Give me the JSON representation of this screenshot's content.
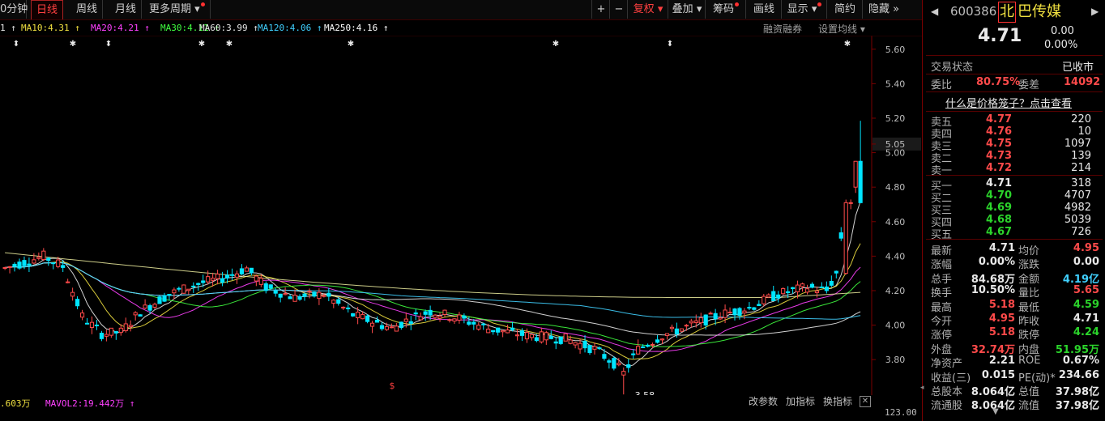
{
  "topbar": {
    "tabs": [
      {
        "label": "0分钟",
        "active": false
      },
      {
        "label": "日线",
        "active": true
      },
      {
        "label": "周线",
        "active": false
      },
      {
        "label": "月线",
        "active": false
      },
      {
        "label": "更多周期",
        "active": false
      }
    ],
    "buttons": [
      "+",
      "−",
      "复权",
      "叠加",
      "筹码",
      "画线",
      "显示",
      "简约",
      "隐藏"
    ]
  },
  "ma_legend": [
    {
      "label": "1 ↑",
      "color": "#e8e8e8"
    },
    {
      "label": "MA10:4.31 ↑",
      "color": "#f0e040"
    },
    {
      "label": "MA20:4.21 ↑",
      "color": "#ff40ff"
    },
    {
      "label": "MA30:4.11 ↑",
      "color": "#40ff40"
    },
    {
      "label": "MA60:3.99 ↑",
      "color": "#e8e8e8"
    },
    {
      "label": "MA120:4.06 ↑",
      "color": "#40d0ff"
    },
    {
      "label": "MA250:4.16 ↑",
      "color": "#ffffff"
    }
  ],
  "chart_opts": [
    "融资融券",
    "设置均线"
  ],
  "chart_data": {
    "type": "candlestick",
    "y_ticks": [
      "5.60",
      "5.40",
      "5.20",
      "5.05",
      "5.00",
      "4.80",
      "4.60",
      "4.40",
      "4.20",
      "4.00",
      "3.80"
    ],
    "ylim": [
      3.66,
      5.66
    ],
    "low_annotation": "3.58",
    "current_price_tag": "5.05",
    "volume_axis_label": "123.00"
  },
  "volume_legend": [
    {
      "label": ".603万",
      "color": "#f0e040"
    },
    {
      "label": "MAVOL2:19.442万 ↑",
      "color": "#ff40ff"
    }
  ],
  "bottom_tools": [
    "改参数",
    "加指标",
    "换指标"
  ],
  "quote": {
    "code": "600386",
    "name_highlight": "北",
    "name_rest": "巴传媒",
    "price": "4.71",
    "change": "0.00",
    "change_pct": "0.00%",
    "status_label": "交易状态",
    "status_value": "已收市",
    "weibi_label": "委比",
    "weibi_value": "80.75%",
    "weicha_label": "委差",
    "weicha_value": "14092",
    "cage_link": "什么是价格笼子？点击查看",
    "asks": [
      {
        "label": "卖五",
        "price": "4.77",
        "vol": "220"
      },
      {
        "label": "卖四",
        "price": "4.76",
        "vol": "10"
      },
      {
        "label": "卖三",
        "price": "4.75",
        "vol": "1097"
      },
      {
        "label": "卖二",
        "price": "4.73",
        "vol": "139"
      },
      {
        "label": "卖一",
        "price": "4.72",
        "vol": "214"
      }
    ],
    "bids": [
      {
        "label": "买一",
        "price": "4.71",
        "vol": "318"
      },
      {
        "label": "买二",
        "price": "4.70",
        "vol": "4707"
      },
      {
        "label": "买三",
        "price": "4.69",
        "vol": "4982"
      },
      {
        "label": "买四",
        "price": "4.68",
        "vol": "5039"
      },
      {
        "label": "买五",
        "price": "4.67",
        "vol": "726"
      }
    ],
    "stats": [
      {
        "l1": "最新",
        "v1": "4.71",
        "c1": "white",
        "l2": "均价",
        "v2": "4.95",
        "c2": "red"
      },
      {
        "l1": "涨幅",
        "v1": "0.00%",
        "c1": "white",
        "l2": "涨跌",
        "v2": "0.00",
        "c2": "white"
      },
      {
        "l1": "总手",
        "v1": "84.68万",
        "c1": "white",
        "l2": "金额",
        "v2": "4.19亿",
        "c2": "cyan"
      },
      {
        "l1": "换手",
        "v1": "10.50%",
        "c1": "white",
        "l2": "量比",
        "v2": "5.65",
        "c2": "red"
      },
      {
        "l1": "最高",
        "v1": "5.18",
        "c1": "red",
        "l2": "最低",
        "v2": "4.59",
        "c2": "green"
      },
      {
        "l1": "今开",
        "v1": "4.95",
        "c1": "red",
        "l2": "昨收",
        "v2": "4.71",
        "c2": "white"
      },
      {
        "l1": "涨停",
        "v1": "5.18",
        "c1": "red",
        "l2": "跌停",
        "v2": "4.24",
        "c2": "green"
      },
      {
        "l1": "外盘",
        "v1": "32.74万",
        "c1": "red",
        "l2": "内盘",
        "v2": "51.95万",
        "c2": "green"
      },
      {
        "l1": "净资产",
        "v1": "2.21",
        "c1": "white",
        "l2": "ROE",
        "v2": "0.67%",
        "c2": "white"
      },
      {
        "l1": "收益(三)",
        "v1": "0.015",
        "c1": "white",
        "l2": "PE(动)*",
        "v2": "234.66",
        "c2": "white"
      },
      {
        "l1": "总股本",
        "v1": "8.064亿",
        "c1": "white",
        "l2": "总值",
        "v2": "37.98亿",
        "c2": "white"
      },
      {
        "l1": "流通股",
        "v1": "8.064亿",
        "c1": "white",
        "l2": "流值",
        "v2": "37.98亿",
        "c2": "white"
      }
    ]
  },
  "colors": {
    "up": "#ff4a4a",
    "down": "#00e5ff",
    "border": "#7a0000"
  }
}
